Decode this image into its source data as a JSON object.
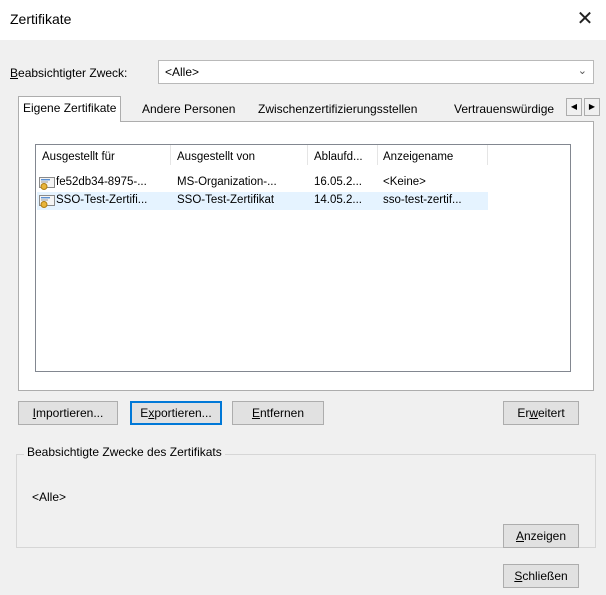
{
  "window": {
    "title": "Zertifikate",
    "close_glyph": "✕"
  },
  "purpose": {
    "label_hotkey": "B",
    "label_rest": "eabsichtigter Zweck:",
    "value": "<Alle>",
    "caret": "⌄"
  },
  "tabs": [
    {
      "label": "Eigene Zertifikate",
      "active": true
    },
    {
      "label": "Andere Personen",
      "active": false
    },
    {
      "label": "Zwischenzertifizierungsstellen",
      "active": false
    },
    {
      "label": "Vertrauenswürdige",
      "active": false
    }
  ],
  "tab_scroll": {
    "left": "◀",
    "right": "▶"
  },
  "table": {
    "columns": [
      "Ausgestellt für",
      "Ausgestellt von",
      "Ablaufd...",
      "Anzeigename"
    ],
    "rows": [
      {
        "issued_to": "fe52db34-8975-...",
        "issued_by": "MS-Organization-...",
        "expires": "16.05.2...",
        "friendly_name": "<Keine>",
        "selected": false
      },
      {
        "issued_to": "SSO-Test-Zertifi...",
        "issued_by": "SSO-Test-Zertifikat",
        "expires": "14.05.2...",
        "friendly_name": "sso-test-zertif...",
        "selected": true
      }
    ]
  },
  "buttons": {
    "import": {
      "hotkey": "I",
      "rest": "mportieren..."
    },
    "export": {
      "pre": "E",
      "hotkey": "x",
      "rest": "portieren..."
    },
    "remove": {
      "hotkey": "E",
      "rest": "ntfernen"
    },
    "advanced": {
      "pre": "Er",
      "hotkey": "w",
      "rest": "eitert"
    },
    "view": {
      "hotkey": "A",
      "rest": "nzeigen"
    },
    "close": {
      "hotkey": "S",
      "rest": "chließen"
    }
  },
  "purposes_group": {
    "title": "Beabsichtigte Zwecke des Zertifikats",
    "value": "<Alle>"
  },
  "colors": {
    "selection": "#e5f3ff",
    "focus_border": "#0078d7",
    "icon_gold": "#e8b43a",
    "icon_blue": "#5a8fd1"
  }
}
